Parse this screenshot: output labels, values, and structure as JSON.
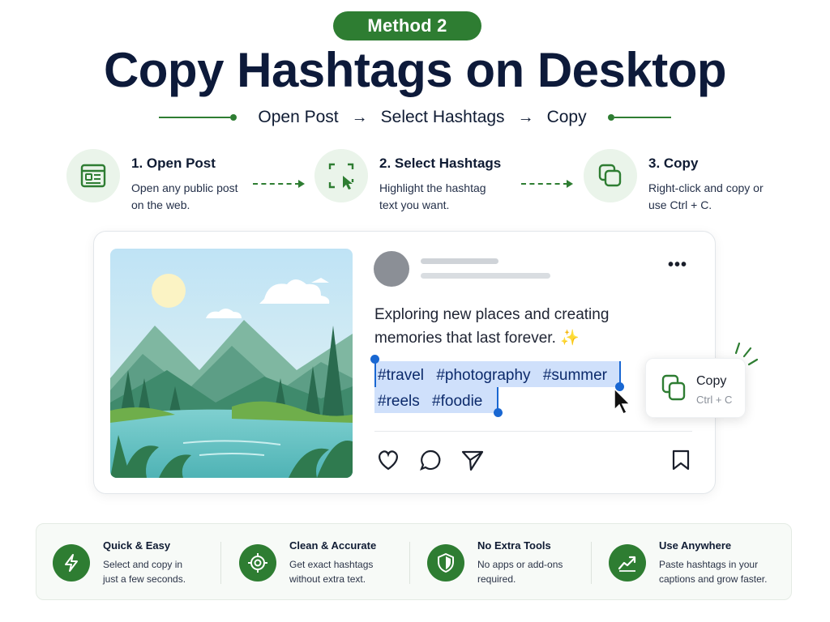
{
  "header": {
    "badge": "Method 2",
    "title": "Copy Hashtags on Desktop",
    "flow": [
      "Open Post",
      "Select Hashtags",
      "Copy"
    ],
    "flow_arrow": "→"
  },
  "steps": [
    {
      "title": "1. Open Post",
      "desc": "Open any public post on the web.",
      "icon": "post-window-icon"
    },
    {
      "title": "2. Select Hashtags",
      "desc": "Highlight the hashtag text you want.",
      "icon": "select-cursor-icon"
    },
    {
      "title": "3. Copy",
      "desc": "Right-click and copy or use Ctrl + C.",
      "icon": "copy-icon"
    }
  ],
  "post": {
    "caption": "Exploring new places and creating memories that last forever. ✨",
    "hashtags_line1": [
      "#travel",
      "#photography",
      "#summer"
    ],
    "hashtags_line2": [
      "#reels",
      "#foodie"
    ],
    "more": "•••"
  },
  "context_menu": {
    "label": "Copy",
    "shortcut": "Ctrl + C"
  },
  "features": [
    {
      "title": "Quick & Easy",
      "desc": "Select and copy in just a few seconds.",
      "icon": "lightning-icon"
    },
    {
      "title": "Clean & Accurate",
      "desc": "Get exact hashtags without extra text.",
      "icon": "target-icon"
    },
    {
      "title": "No Extra Tools",
      "desc": "No apps or add-ons required.",
      "icon": "shield-icon"
    },
    {
      "title": "Use Anywhere",
      "desc": "Paste hashtags in your captions and grow faster.",
      "icon": "growth-chart-icon"
    }
  ],
  "colors": {
    "accent": "#2e7d32",
    "accent_light": "#eaf4ea",
    "selection": "#cfe0fb",
    "selection_caret": "#1967d2",
    "title": "#0d1a3a"
  }
}
